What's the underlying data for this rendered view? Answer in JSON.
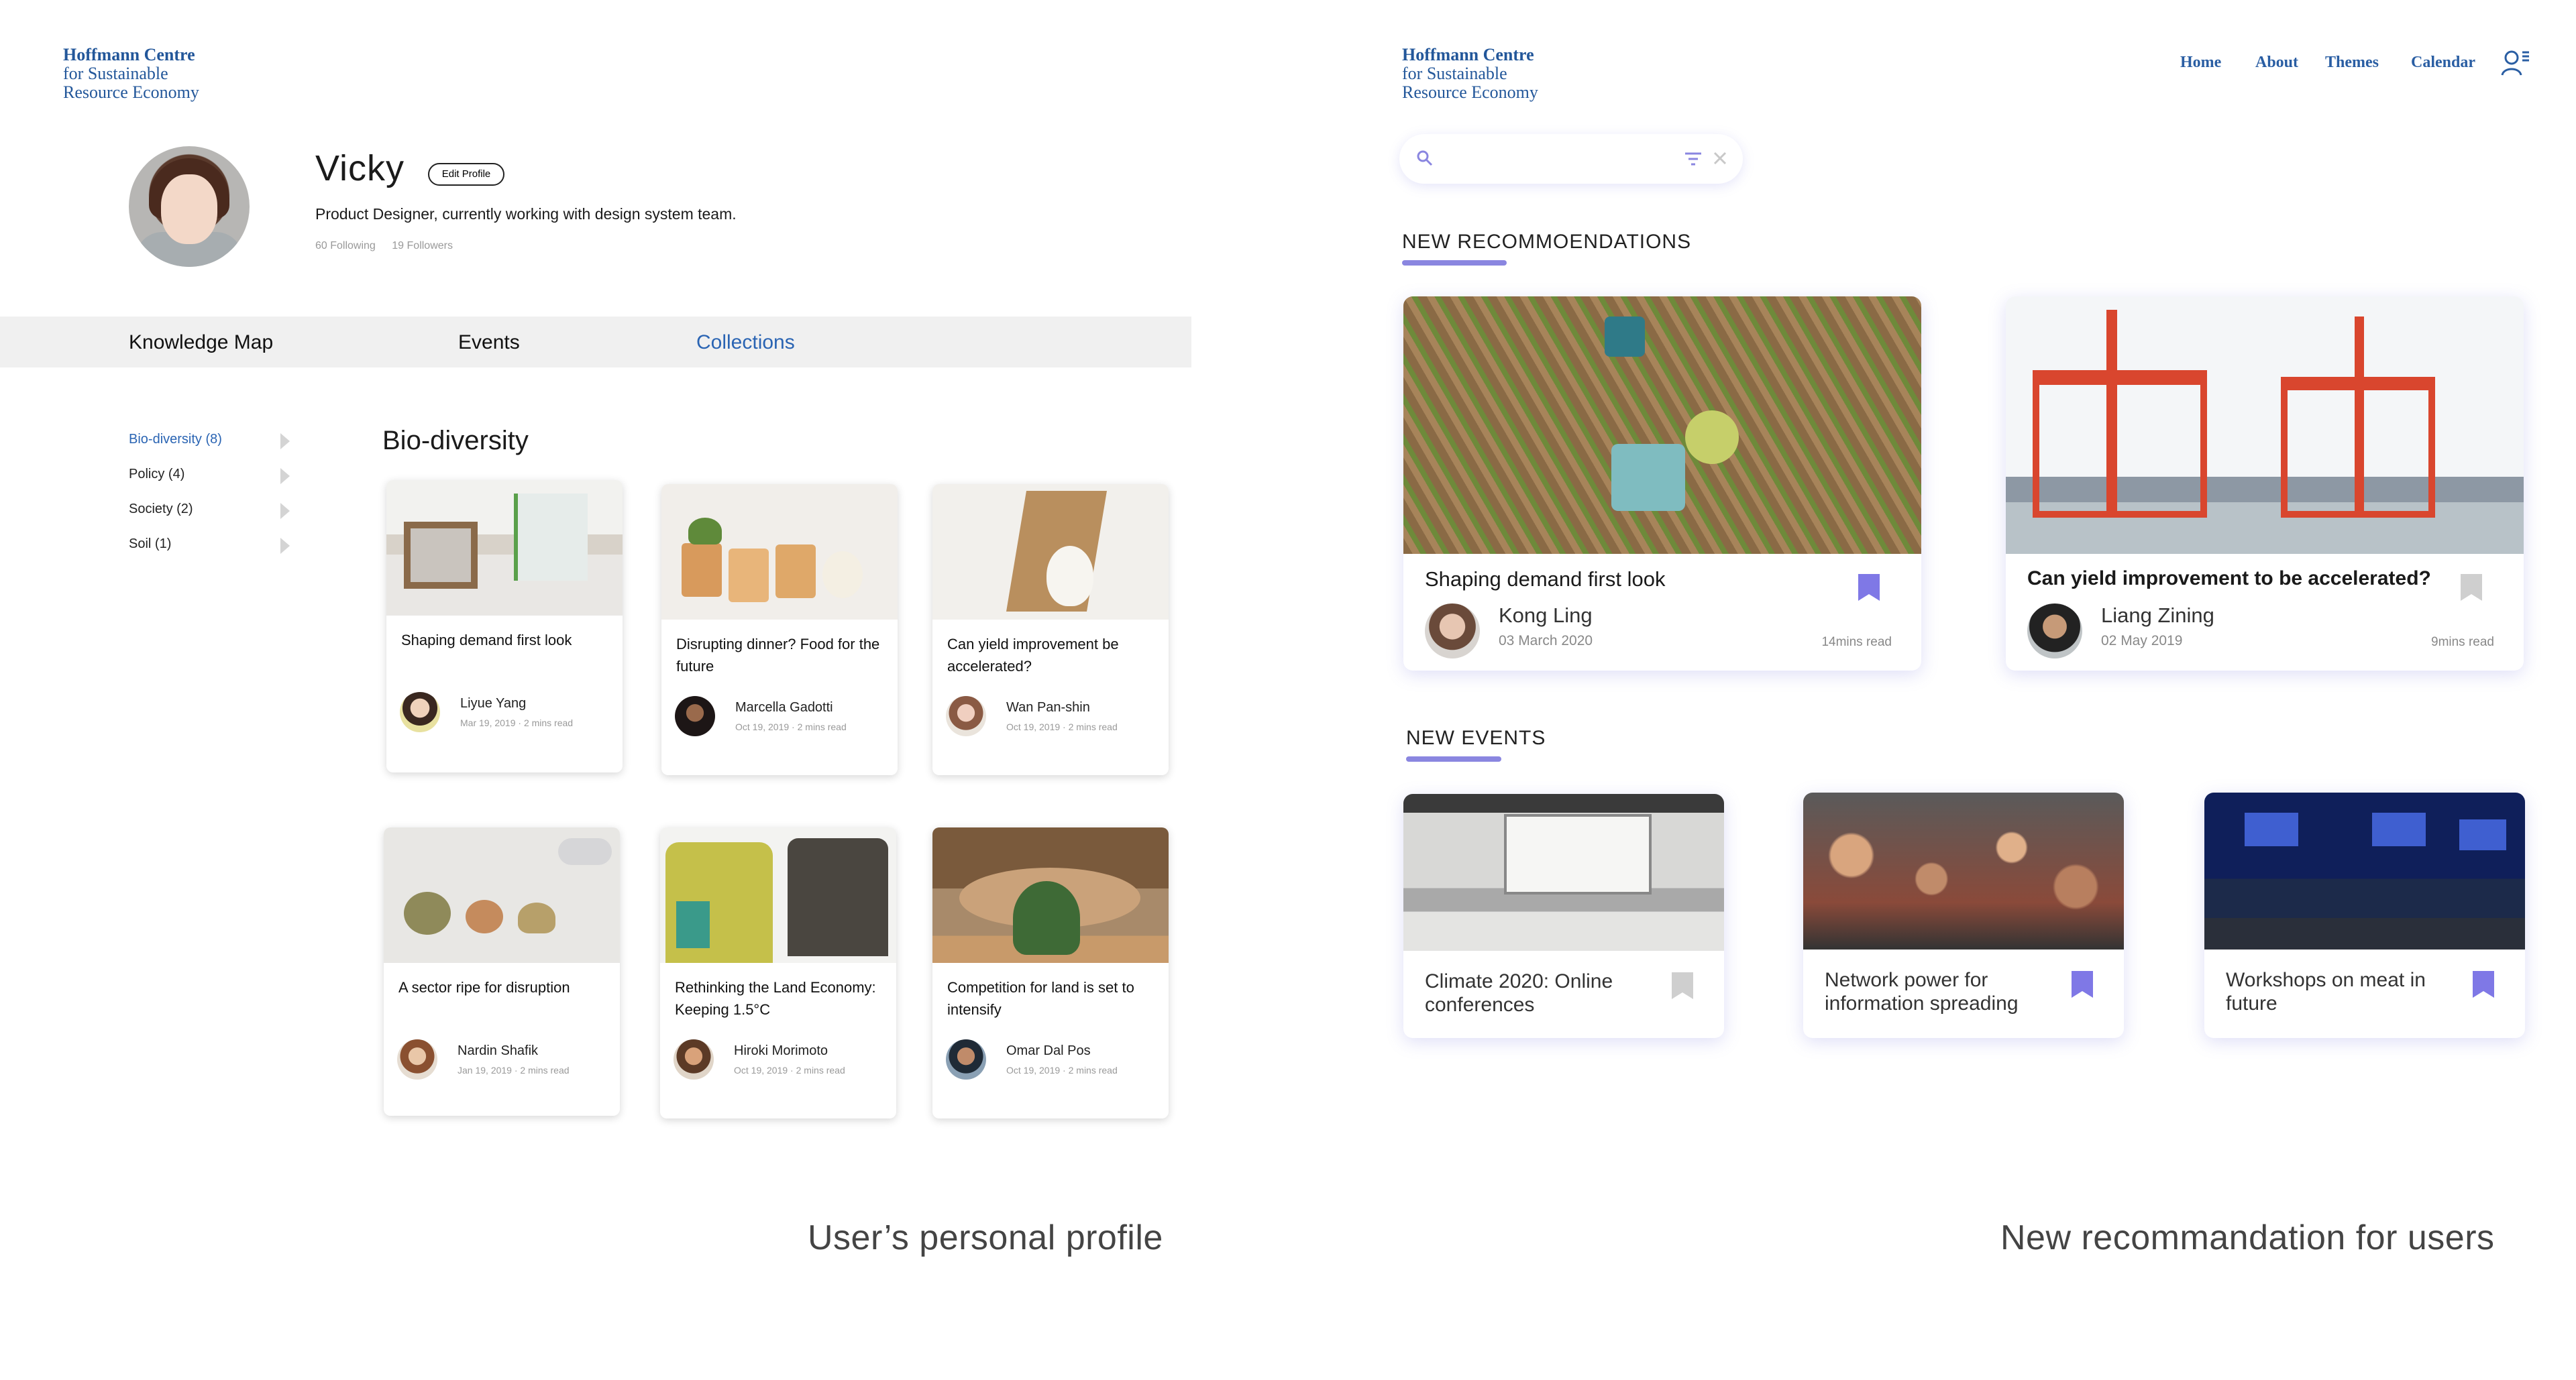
{
  "logo": {
    "line1": "Hoffmann Centre",
    "line2": "for Sustainable",
    "line3": "Resource Economy"
  },
  "profile": {
    "name": "Vicky",
    "edit_label": "Edit Profile",
    "role": "Product Designer, currently working with design system team.",
    "following": "60 Following",
    "followers": "19 Followers"
  },
  "tabs": [
    "Knowledge Map",
    "Events",
    "Collections"
  ],
  "categories": [
    "Bio-diversity (8)",
    "Policy (4)",
    "Society (2)",
    "Soil (1)"
  ],
  "section_title": "Bio-diversity",
  "cards": [
    {
      "title": "Shaping demand first look",
      "author": "Liyue Yang",
      "meta": "Mar 19, 2019 · 2 mins read"
    },
    {
      "title": "Disrupting dinner? Food for the future",
      "author": "Marcella Gadotti",
      "meta": "Oct 19, 2019 · 2 mins read"
    },
    {
      "title": "Can yield improvement be accelerated?",
      "author": "Wan Pan-shin",
      "meta": "Oct 19, 2019 · 2 mins read"
    },
    {
      "title": "A sector ripe for disruption",
      "author": "Nardin Shafik",
      "meta": "Jan 19, 2019 · 2 mins read"
    },
    {
      "title": "Rethinking the Land Economy: Keeping 1.5°C",
      "author": "Hiroki Morimoto",
      "meta": "Oct 19, 2019 · 2 mins read"
    },
    {
      "title": "Competition for land is set to intensify",
      "author": "Omar Dal Pos",
      "meta": "Oct 19, 2019 · 2 mins read"
    }
  ],
  "captions": {
    "left": "User’s personal profile",
    "right": "New recommandation for users"
  },
  "nav": [
    "Home",
    "About",
    "Themes",
    "Calendar"
  ],
  "search": {
    "placeholder": ""
  },
  "recommendations_title": "NEW RECOMMOENDATIONS",
  "recommendations": [
    {
      "title": "Shaping demand first look",
      "author": "Kong Ling",
      "date": "03 March 2020",
      "read": "14mins read",
      "bookmarked": true
    },
    {
      "title": "Can yield improvement to be accelerated?",
      "author": "Liang Zining",
      "date": "02 May 2019",
      "read": "9mins read",
      "bookmarked": false
    }
  ],
  "events_title": "NEW EVENTS",
  "events": [
    {
      "title": "Climate 2020: Online conferences",
      "bookmarked": false
    },
    {
      "title": "Network power for information spreading",
      "bookmarked": true
    },
    {
      "title": "Workshops on meat in future",
      "bookmarked": true
    }
  ],
  "colors": {
    "brand_blue": "#23579a",
    "accent_purple": "#8a86e0",
    "bookmark_active": "#7f78e6",
    "bookmark_inactive": "#cfcfcf"
  },
  "icons": [
    "search-icon",
    "filter-icon",
    "close-icon",
    "user-menu-icon",
    "bookmark-icon",
    "chevron-right-icon"
  ]
}
